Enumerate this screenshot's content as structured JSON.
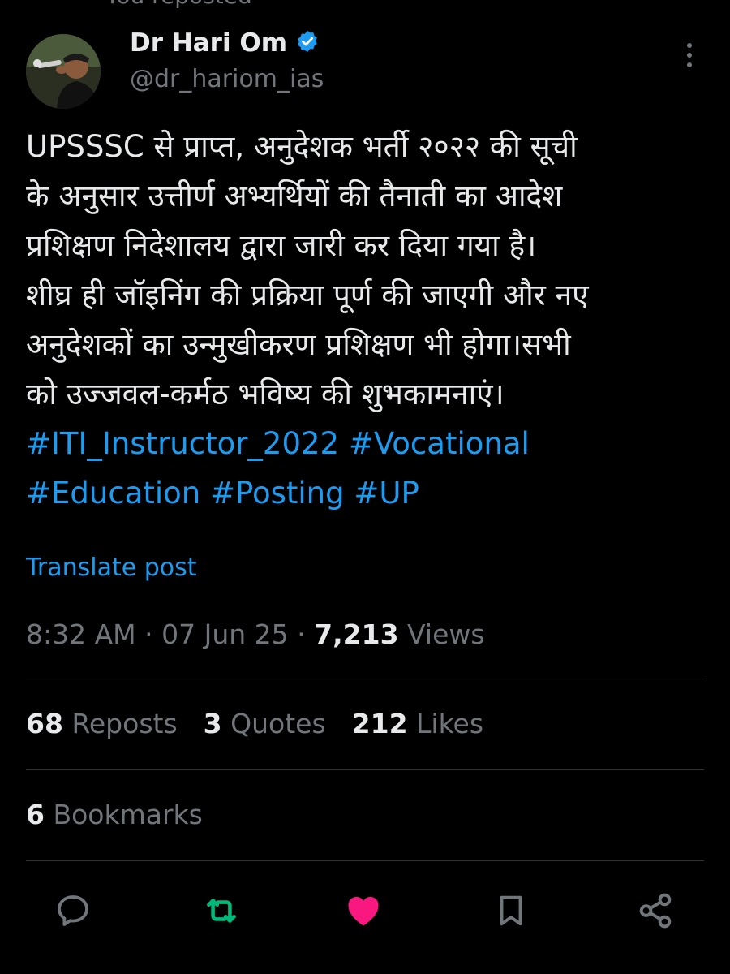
{
  "repost_context": {
    "text": "You reposted"
  },
  "author": {
    "display_name": "Dr Hari Om",
    "handle": "@dr_hariom_ias",
    "verified_color": "#1d9bf0"
  },
  "tweet": {
    "lines": [
      "UPSSSC से प्राप्त, अनुदेशक भर्ती २०२२ की सूची",
      "के अनुसार उत्तीर्ण अभ्यर्थियों की तैनाती का आदेश",
      "प्रशिक्षण निदेशालय द्वारा जारी कर दिया गया है।",
      "शीघ्र ही जॉइनिंग की प्रक्रिया पूर्ण की जाएगी और नए",
      "अनुदेशकों का उन्मुखीकरण प्रशिक्षण भी होगा।सभी",
      "को उज्जवल-कर्मठ भविष्य की शुभकामनाएं।"
    ],
    "hashtags_line1": "#ITI_Instructor_2022 #Vocational",
    "hashtags_line2": "#Education #Posting #UP",
    "translate_label": "Translate post"
  },
  "meta": {
    "time": "8:32 AM",
    "date": "07 Jun 25",
    "views_count": "7,213",
    "views_label": "Views"
  },
  "stats": {
    "reposts_count": "68",
    "reposts_label": "Reposts",
    "quotes_count": "3",
    "quotes_label": "Quotes",
    "likes_count": "212",
    "likes_label": "Likes",
    "bookmarks_count": "6",
    "bookmarks_label": "Bookmarks"
  },
  "actions": {
    "reply_icon": "reply-icon",
    "repost_icon": "repost-icon",
    "like_icon": "like-icon",
    "bookmark_icon": "bookmark-icon",
    "share_icon": "share-icon",
    "repost_active_color": "#00ba7c",
    "like_active_color": "#f91880",
    "icon_color": "#71767b"
  },
  "colors": {
    "background": "#000000",
    "text": "#e7e9ea",
    "secondary_text": "#71767b",
    "link": "#1d9bf0",
    "divider": "#2f3336"
  }
}
